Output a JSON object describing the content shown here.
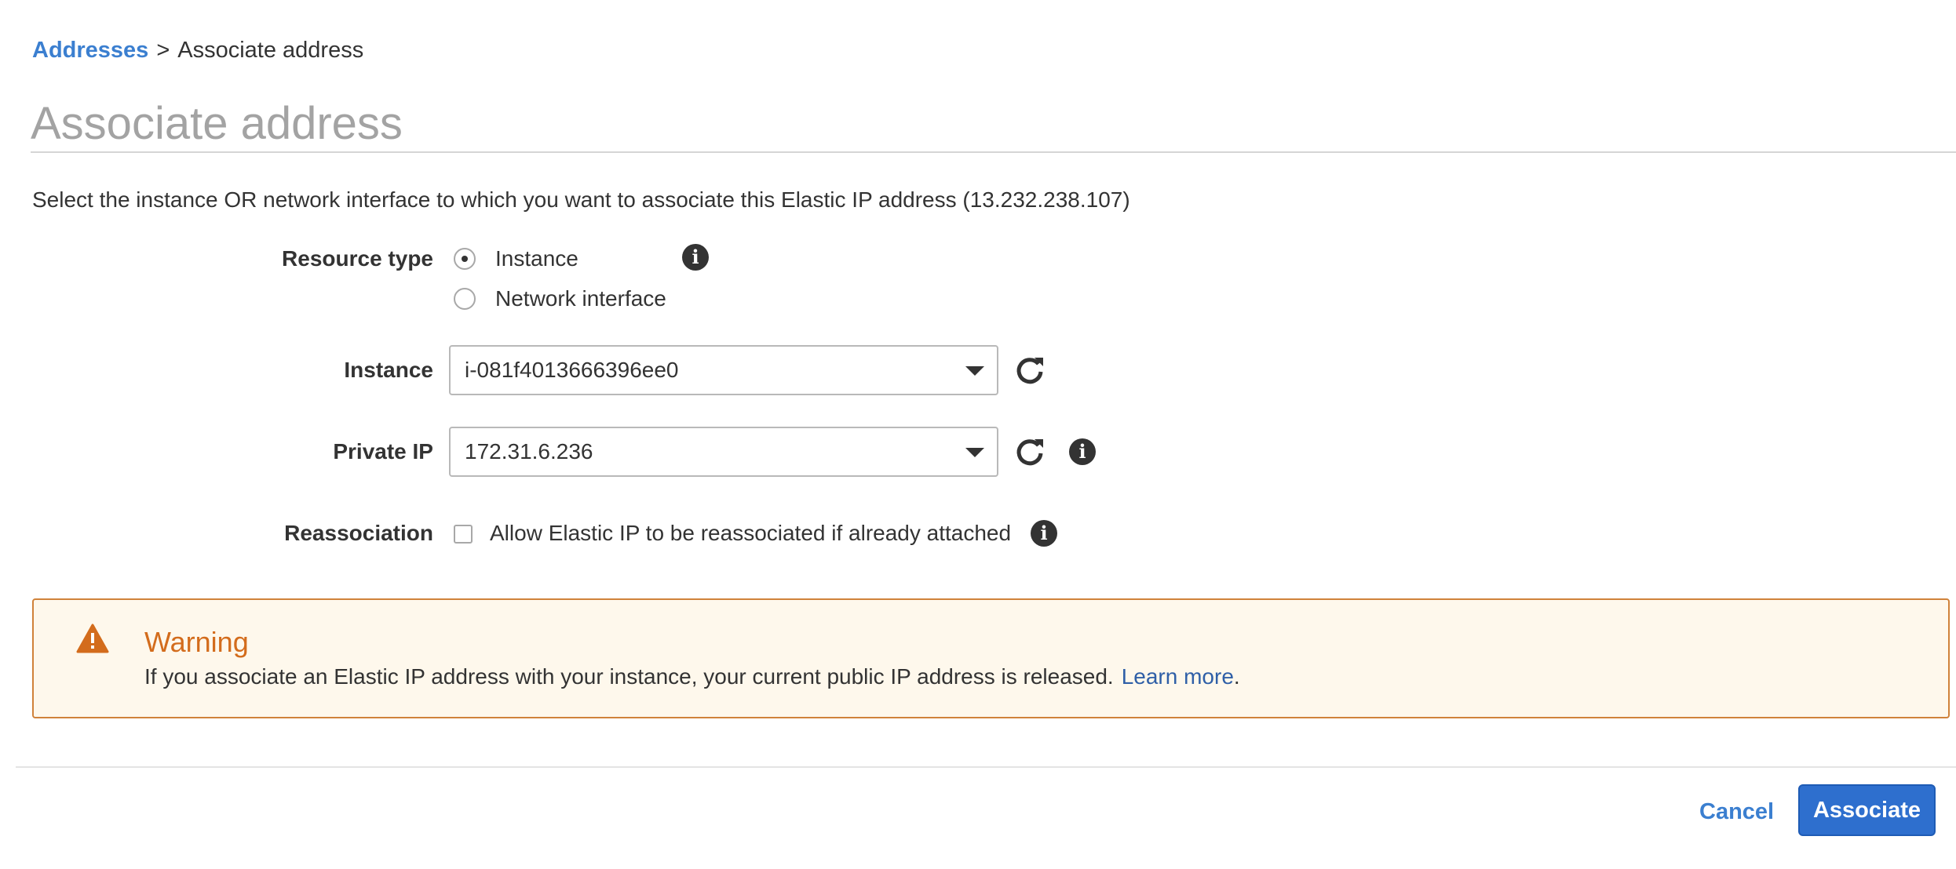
{
  "breadcrumb": {
    "parent": "Addresses",
    "separator": ">",
    "current": "Associate address"
  },
  "page_title": "Associate address",
  "intro_text": "Select the instance OR network interface to which you want to associate this Elastic IP address (13.232.238.107)",
  "form": {
    "resource_type": {
      "label": "Resource type",
      "options": [
        "Instance",
        "Network interface"
      ],
      "selected": "Instance"
    },
    "instance": {
      "label": "Instance",
      "value": "i-081f4013666396ee0"
    },
    "private_ip": {
      "label": "Private IP",
      "value": "172.31.6.236"
    },
    "reassociation": {
      "label": "Reassociation",
      "checkbox_label": "Allow Elastic IP to be reassociated if already attached",
      "checked": false
    }
  },
  "warning": {
    "title": "Warning",
    "text": "If you associate an Elastic IP address with your instance, your current public IP address is released.",
    "link": "Learn more",
    "trailing": "."
  },
  "footer": {
    "cancel_label": "Cancel",
    "associate_label": "Associate"
  },
  "icons": {
    "info": "info-icon",
    "refresh": "refresh-icon",
    "warning": "warning-triangle-icon",
    "dropdown": "chevron-down-icon"
  },
  "colors": {
    "link": "#3b7fd0",
    "primary_button": "#2e6fce",
    "warning_accent": "#d36c1c",
    "warning_background": "#fef8ec"
  }
}
